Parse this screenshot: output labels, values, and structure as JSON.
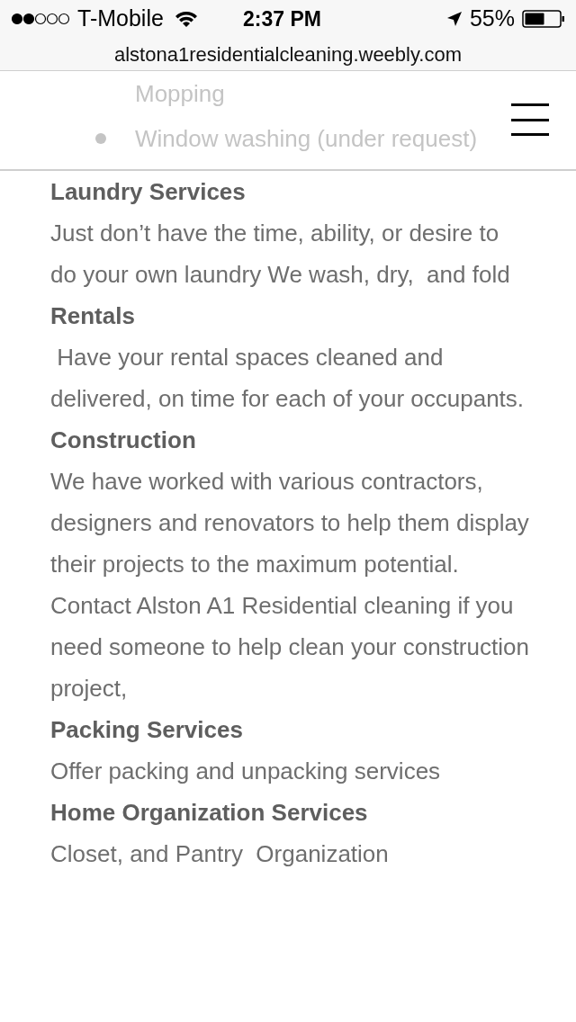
{
  "status_bar": {
    "carrier": "T-Mobile",
    "time": "2:37 PM",
    "battery": "55%"
  },
  "address_bar": {
    "url": "alstona1residentialcleaning.weebly.com"
  },
  "faded_list": [
    {
      "text": "Mopping",
      "bullet": false
    },
    {
      "text": "Window washing (under request)",
      "bullet": true
    }
  ],
  "sections": [
    {
      "heading": "Laundry Services",
      "body": "Just don’t have the time, ability, or desire to do your own laundry We wash, dry,  and fold"
    },
    {
      "heading": "Rentals",
      "body": " Have your rental spaces cleaned and delivered, on time for each of your occupants."
    },
    {
      "heading": "Construction",
      "body": "We have worked with various contractors, designers and renovators to help them display their projects to the maximum potential. Contact Alston A1 Residential cleaning if you need someone to help clean your construction project,"
    },
    {
      "heading": "Packing Services",
      "body": "Offer packing and unpacking services"
    },
    {
      "heading": "Home Organization Services",
      "body": "Closet, and Pantry  Organization"
    }
  ]
}
